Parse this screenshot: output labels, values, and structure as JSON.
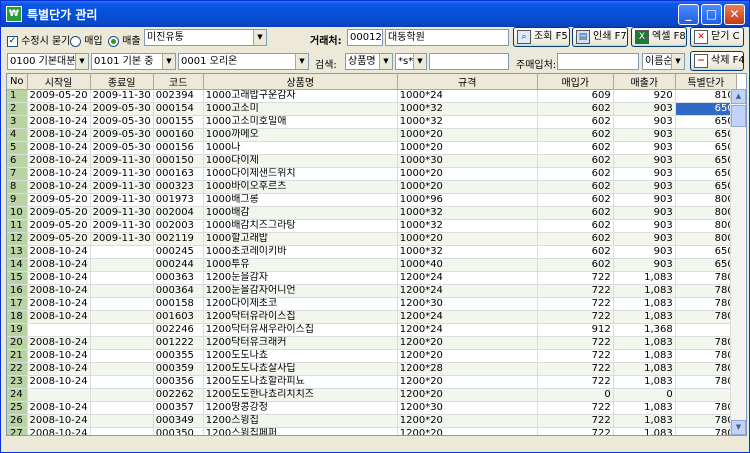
{
  "window": {
    "title": "특별단가 관리",
    "app_icon": "₩"
  },
  "toolbar": {
    "edit_ask_label": "수정시 묻기",
    "radio_buy_label": "매입",
    "radio_sell_label": "매출",
    "store_select": "미진유통",
    "client_label": "거래처:",
    "client_code": "000127",
    "client_name": "대동학원",
    "btn_query": "조회 F5",
    "btn_print": "인쇄 F7",
    "btn_excel": "엑셀 F8",
    "btn_close": "닫기 C",
    "cat1": "0100 기본대분",
    "cat2": "0101 기본 중",
    "cat3": "0001 오리온",
    "search_label": "검색:",
    "search_field": "상품명",
    "search_mode": "*s*",
    "search_value": "",
    "main_client_label": "주매입처:",
    "main_client_value": "",
    "sort_select": "이름순",
    "btn_delete": "삭제 F4"
  },
  "grid": {
    "columns": [
      "No",
      "시작일",
      "종료일",
      "코드",
      "상품명",
      "규격",
      "매입가",
      "매출가",
      "특별단가"
    ],
    "rows": [
      [
        "1",
        "2009-05-20",
        "2009-11-30",
        "002394",
        "1000고래밥구운감자",
        "1000*24",
        "609",
        "920",
        "810"
      ],
      [
        "2",
        "2008-10-24",
        "2009-05-30",
        "000154",
        "1000고소미",
        "1000*32",
        "602",
        "903",
        "650"
      ],
      [
        "3",
        "2008-10-24",
        "2009-05-30",
        "000155",
        "1000고소미호밀애",
        "1000*32",
        "602",
        "903",
        "650"
      ],
      [
        "4",
        "2008-10-24",
        "2009-05-30",
        "000160",
        "1000까메오",
        "1000*20",
        "602",
        "903",
        "650"
      ],
      [
        "5",
        "2008-10-24",
        "2009-05-30",
        "000156",
        "1000나",
        "1000*20",
        "602",
        "903",
        "650"
      ],
      [
        "6",
        "2008-10-24",
        "2009-11-30",
        "000150",
        "1000다이제",
        "1000*30",
        "602",
        "903",
        "650"
      ],
      [
        "7",
        "2008-10-24",
        "2009-11-30",
        "000163",
        "1000다이제샌드위치",
        "1000*20",
        "602",
        "903",
        "650"
      ],
      [
        "8",
        "2008-10-24",
        "2009-11-30",
        "000323",
        "1000바이오후르츠",
        "1000*20",
        "602",
        "903",
        "650"
      ],
      [
        "9",
        "2009-05-20",
        "2009-11-30",
        "001973",
        "1000배그롱",
        "1000*96",
        "602",
        "903",
        "800"
      ],
      [
        "10",
        "2009-05-20",
        "2009-11-30",
        "002004",
        "1000배감",
        "1000*32",
        "602",
        "903",
        "800"
      ],
      [
        "11",
        "2009-05-20",
        "2009-11-30",
        "002003",
        "1000배감치즈그라탕",
        "1000*32",
        "602",
        "903",
        "800"
      ],
      [
        "12",
        "2009-05-20",
        "2009-11-30",
        "002119",
        "1000할고래밥",
        "1000*20",
        "602",
        "903",
        "800"
      ],
      [
        "13",
        "2008-10-24",
        "",
        "000245",
        "1000초코레이키바",
        "1000*32",
        "602",
        "903",
        "650"
      ],
      [
        "14",
        "2008-10-24",
        "",
        "000244",
        "1000투유",
        "1000*40",
        "602",
        "903",
        "650"
      ],
      [
        "15",
        "2008-10-24",
        "",
        "000363",
        "1200눈을감자",
        "1200*24",
        "722",
        "1,083",
        "780"
      ],
      [
        "16",
        "2008-10-24",
        "",
        "000364",
        "1200눈을감자어니언",
        "1200*24",
        "722",
        "1,083",
        "780"
      ],
      [
        "17",
        "2008-10-24",
        "",
        "000158",
        "1200다이제초코",
        "1200*30",
        "722",
        "1,083",
        "780"
      ],
      [
        "18",
        "2008-10-24",
        "",
        "001603",
        "1200닥터유라이스칩",
        "1200*24",
        "722",
        "1,083",
        "780"
      ],
      [
        "19",
        "",
        "",
        "002246",
        "1200닥터유새우라이스칩",
        "1200*24",
        "912",
        "1,368",
        ""
      ],
      [
        "20",
        "2008-10-24",
        "",
        "001222",
        "1200닥터유크래커",
        "1200*20",
        "722",
        "1,083",
        "780"
      ],
      [
        "21",
        "2008-10-24",
        "",
        "000355",
        "1200도도나쵸",
        "1200*20",
        "722",
        "1,083",
        "780"
      ],
      [
        "22",
        "2008-10-24",
        "",
        "000359",
        "1200도도나쵸살사딥",
        "1200*28",
        "722",
        "1,083",
        "780"
      ],
      [
        "23",
        "2008-10-24",
        "",
        "000356",
        "1200도도나쵸할라피뇨",
        "1200*20",
        "722",
        "1,083",
        "780"
      ],
      [
        "24",
        "",
        "",
        "002262",
        "1200도도한나쵸리치치즈",
        "1200*20",
        "0",
        "0",
        ""
      ],
      [
        "25",
        "2008-10-24",
        "",
        "000357",
        "1200땅콩강정",
        "1200*30",
        "722",
        "1,083",
        "780"
      ],
      [
        "26",
        "2008-10-24",
        "",
        "000349",
        "1200스윙칩",
        "1200*20",
        "722",
        "1,083",
        "780"
      ],
      [
        "27",
        "2008-10-24",
        "",
        "000350",
        "1200스윙칩페퍼",
        "1200*20",
        "722",
        "1,083",
        "780"
      ]
    ],
    "selected_row": 2
  }
}
